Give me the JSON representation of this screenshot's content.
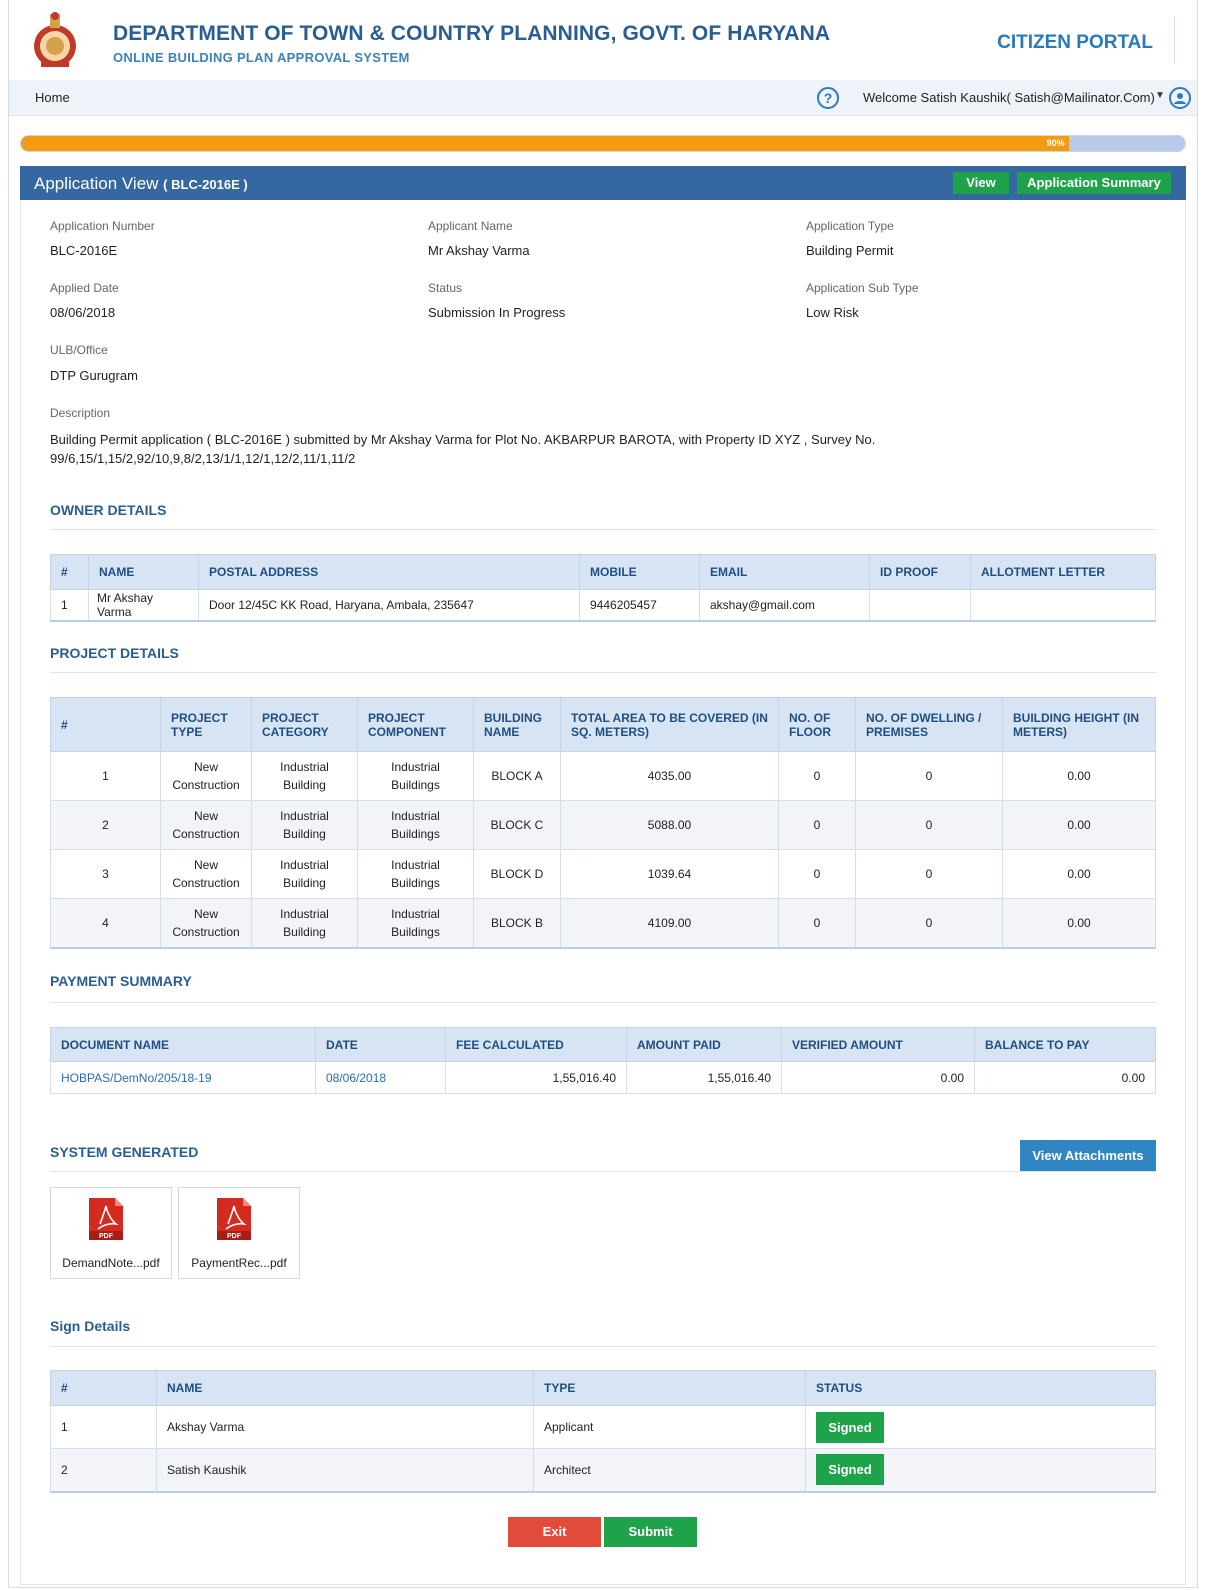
{
  "header": {
    "title": "DEPARTMENT OF TOWN & COUNTRY PLANNING, GOVT. OF HARYANA",
    "subtitle": "ONLINE BUILDING PLAN APPROVAL SYSTEM",
    "portal": "CITIZEN PORTAL"
  },
  "nav": {
    "home": "Home",
    "help_icon": "help-circle-icon",
    "welcome": "Welcome Satish Kaushik( Satish@Mailinator.Com)",
    "user_icon": "user-circle-icon"
  },
  "progress": {
    "percent_label": "90%",
    "fraction": 0.9
  },
  "app_view": {
    "title": "Application View",
    "code": "( BLC-2016E )",
    "view_btn": "View",
    "summary_btn": "Application Summary"
  },
  "fields": {
    "app_number_label": "Application Number",
    "app_number": "BLC-2016E",
    "applicant_label": "Applicant Name",
    "applicant": "Mr Akshay Varma",
    "type_label": "Application Type",
    "type": "Building Permit",
    "applied_label": "Applied Date",
    "applied": "08/06/2018",
    "status_label": "Status",
    "status": "Submission In Progress",
    "subtype_label": "Application Sub Type",
    "subtype": "Low Risk",
    "ulb_label": "ULB/Office",
    "ulb": "DTP Gurugram",
    "desc_label": "Description",
    "desc": "Building Permit application ( BLC-2016E ) submitted by Mr Akshay Varma for Plot No. AKBARPUR BAROTA, with Property ID XYZ , Survey No. 99/6,15/1,15/2,92/10,9,8/2,13/1/1,12/1,12/2,11/1,11/2"
  },
  "owner": {
    "title": "OWNER DETAILS",
    "headers": [
      "#",
      "NAME",
      "POSTAL ADDRESS",
      "MOBILE",
      "EMAIL",
      "ID PROOF",
      "ALLOTMENT LETTER"
    ],
    "rows": [
      [
        "1",
        "Mr Akshay Varma",
        "Door 12/45C KK Road, Haryana, Ambala, 235647",
        "9446205457",
        "akshay@gmail.com",
        "",
        ""
      ]
    ]
  },
  "project": {
    "title": "PROJECT DETAILS",
    "headers": [
      "#",
      "PROJECT TYPE",
      "PROJECT CATEGORY",
      "PROJECT COMPONENT",
      "BUILDING NAME",
      "TOTAL AREA TO BE COVERED (IN SQ. METERS)",
      "NO. OF FLOOR",
      "NO. OF DWELLING / PREMISES",
      "BUILDING HEIGHT (IN METERS)"
    ],
    "rows": [
      [
        "1",
        "New Construction",
        "Industrial Building",
        "Industrial Buildings",
        "BLOCK A",
        "4035.00",
        "0",
        "0",
        "0.00"
      ],
      [
        "2",
        "New Construction",
        "Industrial Building",
        "Industrial Buildings",
        "BLOCK C",
        "5088.00",
        "0",
        "0",
        "0.00"
      ],
      [
        "3",
        "New Construction",
        "Industrial Building",
        "Industrial Buildings",
        "BLOCK D",
        "1039.64",
        "0",
        "0",
        "0.00"
      ],
      [
        "4",
        "New Construction",
        "Industrial Building",
        "Industrial Buildings",
        "BLOCK B",
        "4109.00",
        "0",
        "0",
        "0.00"
      ]
    ]
  },
  "payment": {
    "title": "PAYMENT SUMMARY",
    "headers": [
      "DOCUMENT NAME",
      "DATE",
      "FEE CALCULATED",
      "AMOUNT PAID",
      "VERIFIED AMOUNT",
      "BALANCE TO PAY"
    ],
    "rows": [
      [
        "HOBPAS/DemNo/205/18-19",
        "08/06/2018",
        "1,55,016.40",
        "1,55,016.40",
        "0.00",
        "0.00"
      ]
    ]
  },
  "system": {
    "title": "SYSTEM GENERATED",
    "attach_btn": "View Attachments",
    "files": [
      {
        "name": "DemandNote...pdf",
        "icon": "pdf-file-icon",
        "badge": "PDF"
      },
      {
        "name": "PaymentRec...pdf",
        "icon": "pdf-file-icon",
        "badge": "PDF"
      }
    ]
  },
  "sign": {
    "title": "Sign Details",
    "headers": [
      "#",
      "NAME",
      "TYPE",
      "STATUS"
    ],
    "rows": [
      [
        "1",
        "Akshay Varma",
        "Applicant",
        "Signed"
      ],
      [
        "2",
        "Satish Kaushik",
        "Architect",
        "Signed"
      ]
    ]
  },
  "actions": {
    "exit": "Exit",
    "submit": "Submit"
  },
  "colors": {
    "primary": "#3567a1",
    "green": "#1fa34a",
    "orange": "#f39c12",
    "red": "#e04b3a"
  }
}
